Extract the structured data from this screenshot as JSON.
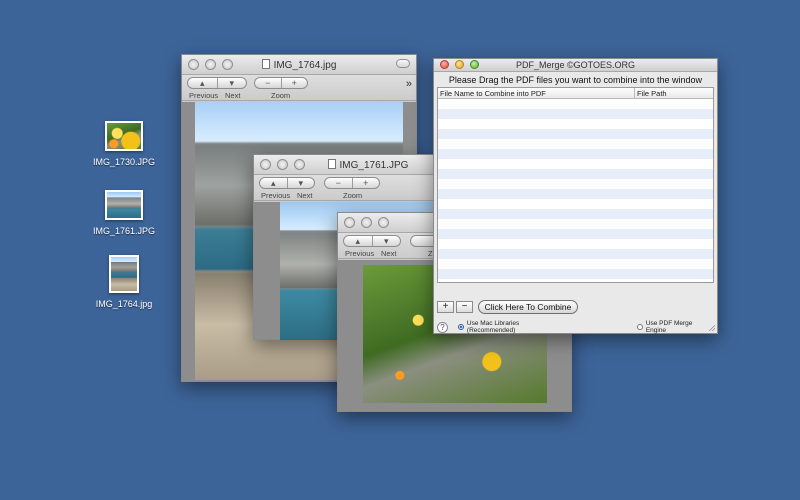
{
  "desktop": {
    "icons": [
      {
        "name": "IMG_1730.JPG"
      },
      {
        "name": "IMG_1761.JPG"
      },
      {
        "name": "IMG_1764.jpg"
      }
    ]
  },
  "preview_windows": [
    {
      "title": "IMG_1764.jpg",
      "previous": "Previous",
      "next": "Next",
      "zoom": "Zoom",
      "zoom_out": "−",
      "zoom_in": "+",
      "more": "»"
    },
    {
      "title": "IMG_1761.JPG",
      "previous": "Previous",
      "next": "Next",
      "zoom": "Zoom",
      "zoom_out": "−",
      "zoom_in": "+"
    },
    {
      "previous": "Previous",
      "next": "Next",
      "zoom_partial": "Z"
    }
  ],
  "pdf_merge": {
    "title": "PDF_Merge ©GOTOES.ORG",
    "instruction": "Please Drag the PDF files you want to combine into the window",
    "columns": [
      "File Name to Combine into PDF",
      "File Path"
    ],
    "add_label": "+",
    "remove_label": "−",
    "combine_label": "Click Here To Combine",
    "help_label": "?",
    "options": [
      "Use Mac Libraries (Recommended)",
      "Use PDF Merge Engine"
    ],
    "selected_option": "Use Mac Libraries (Recommended)"
  },
  "colors": {
    "desktop": "#3d6499",
    "selected_radio": "#2f6fd1"
  }
}
